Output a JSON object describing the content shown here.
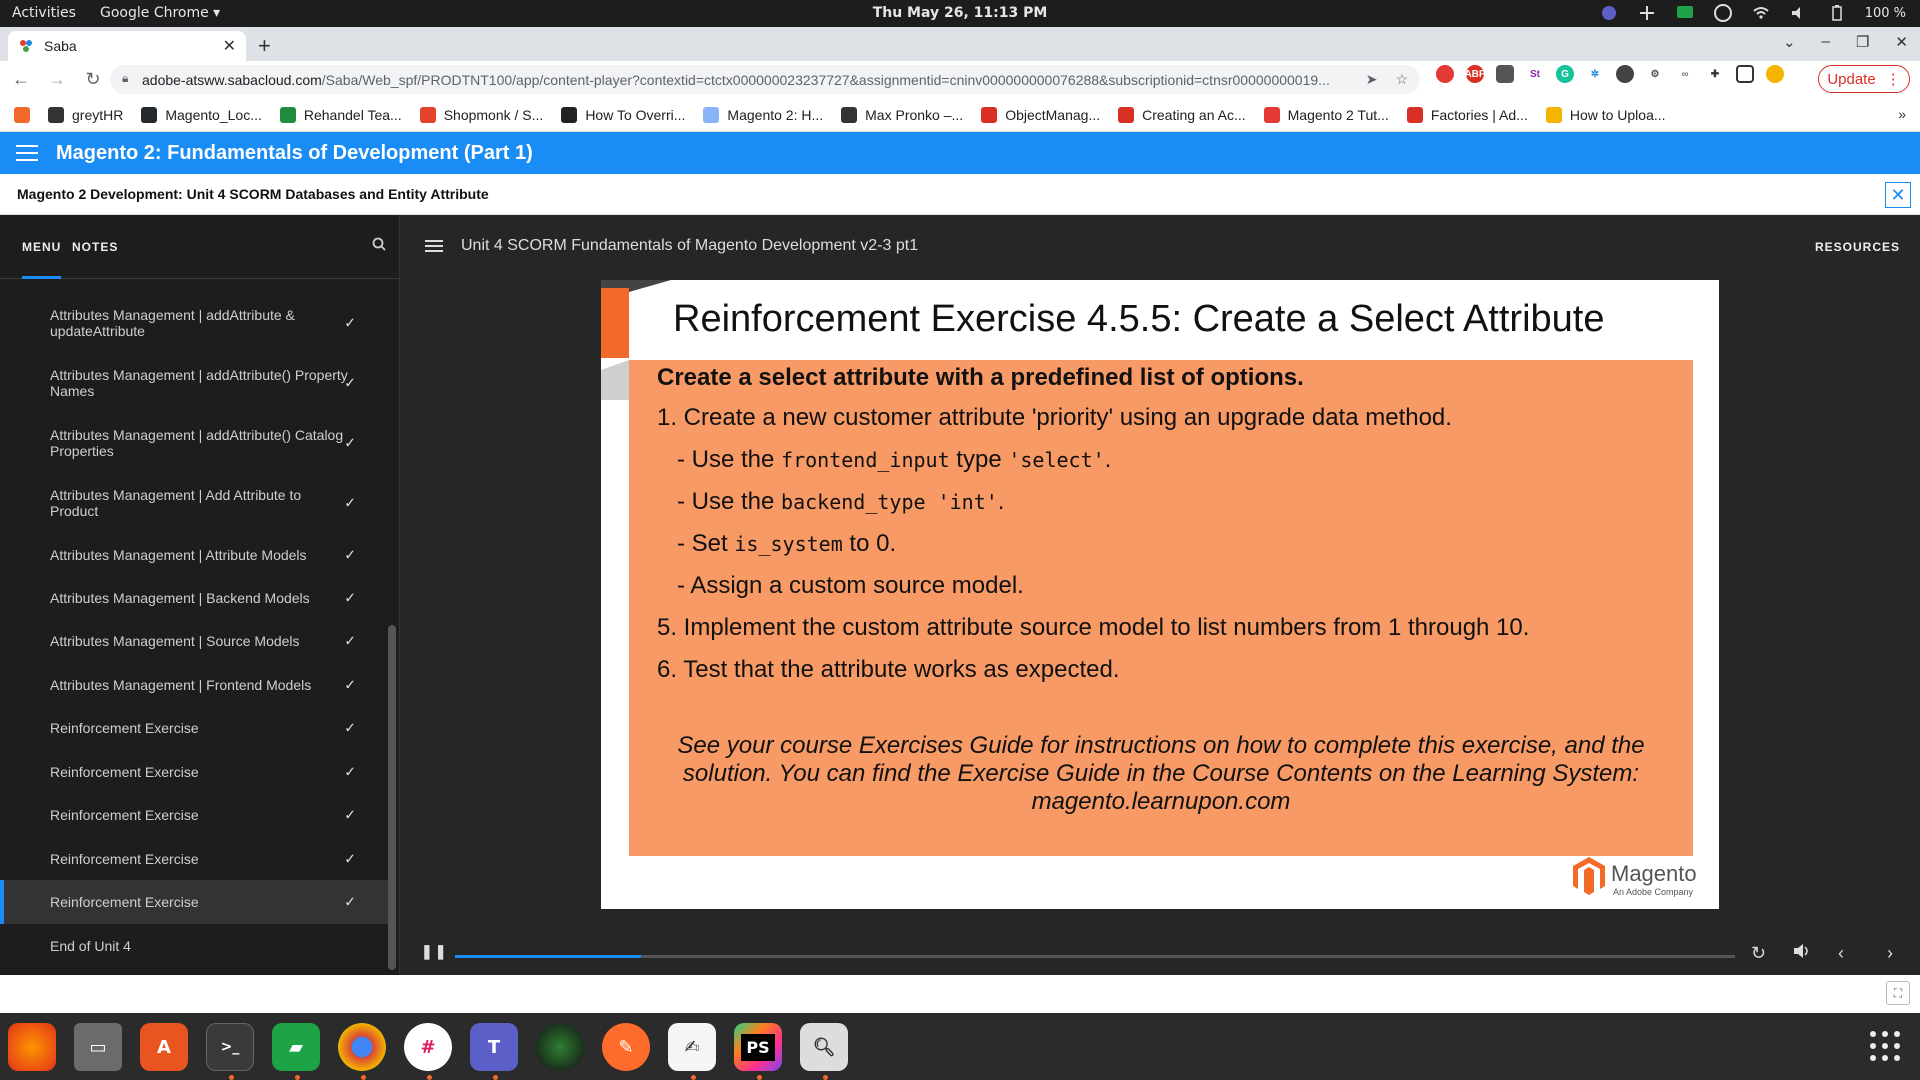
{
  "system": {
    "activities": "Activities",
    "app_name": "Google Chrome ▾",
    "clock": "Thu May 26, 11:13 PM",
    "battery": "100 %"
  },
  "browser": {
    "tab_title": "Saba",
    "url_host": "adobe-atsww.sabacloud.com",
    "url_path": "/Saba/Web_spf/PRODTNT100/app/content-player?contextid=ctctx000000023237727&assignmentid=cninv000000000076288&subscriptionid=ctnsr00000000019...",
    "update_label": "Update",
    "bookmarks": [
      {
        "label": "",
        "color": "#f26a2a"
      },
      {
        "label": "greytHR",
        "color": "#333333"
      },
      {
        "label": "Magento_Loc...",
        "color": "#24292e"
      },
      {
        "label": "Rehandel Tea...",
        "color": "#1e8e3e"
      },
      {
        "label": "Shopmonk / S...",
        "color": "#e2432a"
      },
      {
        "label": "How To Overri...",
        "color": "#222222"
      },
      {
        "label": "Magento 2: H...",
        "color": "#8ab4f8"
      },
      {
        "label": "Max Pronko –...",
        "color": "#333333"
      },
      {
        "label": "ObjectManag...",
        "color": "#d93025"
      },
      {
        "label": "Creating an Ac...",
        "color": "#d93025"
      },
      {
        "label": "Magento 2 Tut...",
        "color": "#e53935"
      },
      {
        "label": "Factories | Ad...",
        "color": "#d93025"
      },
      {
        "label": "How to Uploa...",
        "color": "#f4b400"
      }
    ],
    "bookmarks_more": "»"
  },
  "app": {
    "course_title": "Magento 2: Fundamentals of Development (Part 1)",
    "unit_title": "Magento 2 Development: Unit 4 SCORM Databases and Entity Attribute",
    "close": "✕",
    "sidebar_tabs": {
      "menu": "MENU",
      "notes": "NOTES"
    },
    "module_title": "Unit 4 SCORM Fundamentals of Magento Development v2-3 pt1",
    "resources": "RESOURCES",
    "menu_items": [
      {
        "label": "Attributes Management | addAttribute & updateAttribute",
        "h": 60
      },
      {
        "label": "Attributes Management | addAttribute() Property Names",
        "h": 60
      },
      {
        "label": "Attributes Management | addAttribute() Catalog Properties",
        "h": 60
      },
      {
        "label": "Attributes Management | Add Attribute to Product",
        "h": 60
      },
      {
        "label": "Attributes Management | Attribute Models",
        "h": 43
      },
      {
        "label": "Attributes Management | Backend Models",
        "h": 43
      },
      {
        "label": "Attributes Management | Source Models",
        "h": 44
      },
      {
        "label": "Attributes Management | Frontend Models",
        "h": 43
      },
      {
        "label": "Reinforcement Exercise",
        "h": 44
      },
      {
        "label": "Reinforcement Exercise",
        "h": 43
      },
      {
        "label": "Reinforcement Exercise",
        "h": 44
      },
      {
        "label": "Reinforcement Exercise",
        "h": 43
      },
      {
        "label": "Reinforcement Exercise",
        "h": 44,
        "active": true
      },
      {
        "label": "End of Unit 4",
        "h": 43,
        "nocheck": true
      }
    ],
    "progress_fraction": 0.145
  },
  "slide": {
    "title": "Reinforcement Exercise 4.5.5: Create a Select Attribute",
    "heading": "Create a select attribute with a predefined list of options.",
    "step1": "1. Create a new customer attribute 'priority' using an upgrade data method.",
    "sub1_pre": "- Use the",
    "sub1_code": "frontend_input",
    "sub1_mid": "type",
    "sub1_code2": "'select'",
    "sub1_end": ".",
    "sub2_pre": "- Use the",
    "sub2_code": "backend_type 'int'",
    "sub2_end": ".",
    "sub3_pre": "- Set",
    "sub3_code": "is_system",
    "sub3_end": "to 0.",
    "sub4": "- Assign a custom source model.",
    "step5": "5. Implement the custom attribute source model to list numbers from 1 through 10.",
    "step6": "6. Test that the attribute works as expected.",
    "note": "See your course Exercises Guide for instructions on how to complete this exercise, and the solution. You can find the Exercise Guide in the Course Contents on the Learning System: magento.learnupon.com",
    "logo_brand": "Magento",
    "logo_sub": "An Adobe Company"
  },
  "colors": {
    "brand_blue": "#1a8cf5",
    "slide_orange_box": "#f79a66",
    "magento_orange": "#f26a2a"
  }
}
